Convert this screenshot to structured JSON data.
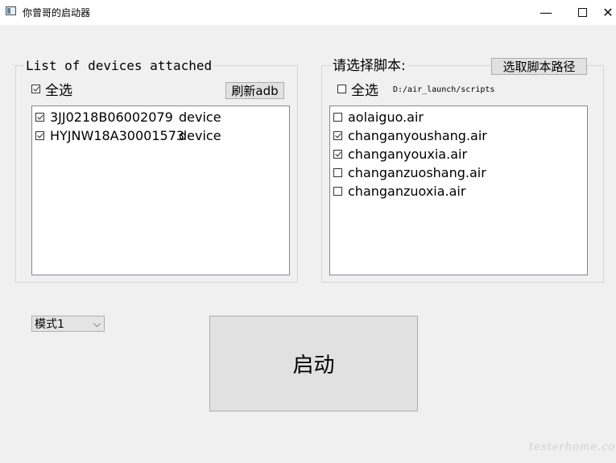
{
  "window": {
    "title": "你曾哥的启动器",
    "minimize_glyph": "—",
    "close_glyph": "✕"
  },
  "devices": {
    "group_title": "List of devices attached",
    "select_all_label": "全选",
    "select_all_checked": true,
    "refresh_button": "刷新adb",
    "items": [
      {
        "serial": "3JJ0218B06002079",
        "state": "device",
        "checked": true
      },
      {
        "serial": "HYJNW18A30001573",
        "state": "device",
        "checked": true
      }
    ]
  },
  "scripts": {
    "group_title": "请选择脚本:",
    "choose_path_button": "选取脚本路径",
    "select_all_label": "全选",
    "select_all_checked": false,
    "path": "D:/air_launch/scripts",
    "items": [
      {
        "name": "aolaiguo.air",
        "checked": false
      },
      {
        "name": "changanyoushang.air",
        "checked": true
      },
      {
        "name": "changanyouxia.air",
        "checked": true
      },
      {
        "name": "changanzuoshang.air",
        "checked": false
      },
      {
        "name": "changanzuoxia.air",
        "checked": false
      }
    ]
  },
  "mode": {
    "selected": "模式1"
  },
  "start_button": "启动",
  "watermark": "testerhome.com"
}
